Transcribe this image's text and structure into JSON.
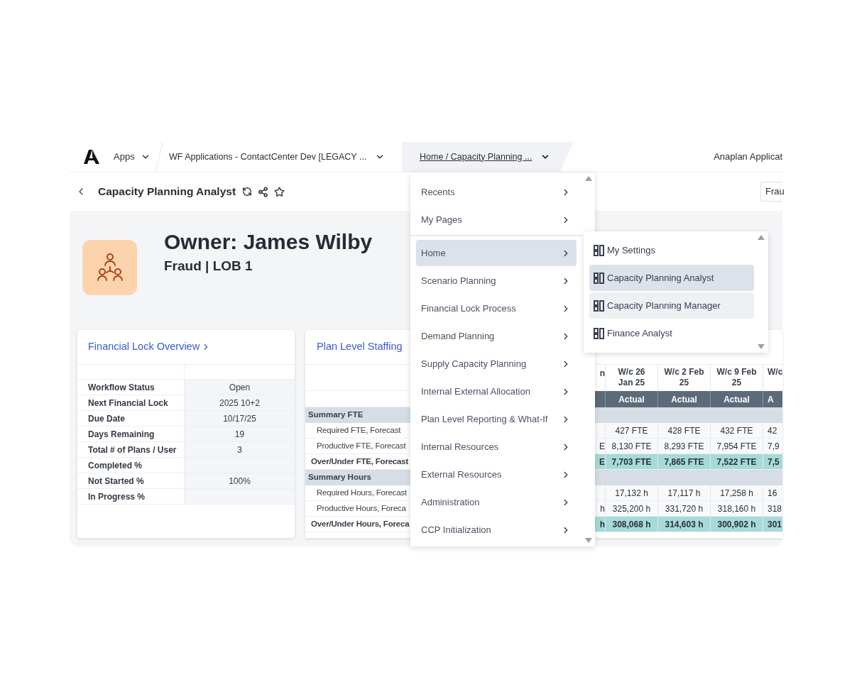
{
  "top_bar": {
    "apps": "Apps",
    "model": "WF Applications - ContactCenter Dev [LEGACY ...",
    "page": "Home / Capacity Planning ...",
    "tenant": "Anaplan Applicat"
  },
  "page_bar": {
    "title": "Capacity Planning Analyst",
    "filter": "Frau"
  },
  "header": {
    "title": "Owner: James Wilby",
    "subtitle": "Fraud | LOB 1"
  },
  "lock_card": {
    "title": "Financial Lock Overview",
    "rows": [
      {
        "label": "Workflow Status",
        "value": "Open"
      },
      {
        "label": "Next Financial Lock",
        "value": "2025 10+2"
      },
      {
        "label": "Due Date",
        "value": "10/17/25"
      },
      {
        "label": "Days Remaining",
        "value": "19"
      },
      {
        "label": "Total # of Plans / User",
        "value": "3"
      },
      {
        "label": "Completed %"
      },
      {
        "label": "Not Started %",
        "value": "100%"
      },
      {
        "label": "In Progress %"
      }
    ]
  },
  "staffing_card": {
    "title": "Plan Level Staffing",
    "edge_heading": "n",
    "columns": [
      {
        "heading": "W/c 26 Jan 25",
        "sub": "Actual"
      },
      {
        "heading": "W/c 2 Feb 25",
        "sub": "Actual"
      },
      {
        "heading": "W/c 9 Feb 25",
        "sub": "Actual"
      },
      {
        "heading": "W/c",
        "sub": "A"
      }
    ],
    "rows": [
      {
        "kind": "section",
        "label": "Summary FTE"
      },
      {
        "kind": "line",
        "label": "Required FTE, Forecast",
        "cells": [
          "427 FTE",
          "428 FTE",
          "432 FTE",
          "42"
        ]
      },
      {
        "kind": "line",
        "label": "Productive FTE, Forecast",
        "edge": "E",
        "cells": [
          "8,130 FTE",
          "8,293 FTE",
          "7,954 FTE",
          "7,9"
        ]
      },
      {
        "kind": "total",
        "label": "Over/Under FTE, Forecast",
        "edge": "E",
        "cells": [
          "7,703 FTE",
          "7,865 FTE",
          "7,522 FTE",
          "7,5"
        ]
      },
      {
        "kind": "section",
        "label": "Summary Hours"
      },
      {
        "kind": "line",
        "label": "Required Hours, Forecast",
        "cells": [
          "17,132 h",
          "17,117 h",
          "17,258 h",
          "16"
        ]
      },
      {
        "kind": "line",
        "label": "Productive Hours, Foreca",
        "edge": "h",
        "cells": [
          "325,200 h",
          "331,720 h",
          "318,160 h",
          "318"
        ]
      },
      {
        "kind": "total",
        "label": "Over/Under Hours, Foreca",
        "edge": "h",
        "cells": [
          "308,068 h",
          "314,603 h",
          "300,902 h",
          "301"
        ]
      }
    ]
  },
  "menu": {
    "groups": [
      [
        {
          "label": "Recents",
          "selected": false
        },
        {
          "label": "My Pages",
          "selected": false
        }
      ],
      [
        {
          "label": "Home",
          "selected": true
        },
        {
          "label": "Scenario Planning",
          "selected": false
        },
        {
          "label": "Financial Lock Process",
          "selected": false
        },
        {
          "label": "Demand Planning",
          "selected": false
        },
        {
          "label": "Supply Capacity Planning",
          "selected": false
        },
        {
          "label": "Internal External Allocation",
          "selected": false
        },
        {
          "label": "Plan Level Reporting & What-If",
          "selected": false
        },
        {
          "label": "Internal Resources",
          "selected": false
        },
        {
          "label": "External Resources",
          "selected": false
        },
        {
          "label": "Administration",
          "selected": false
        },
        {
          "label": "CCP Initialization",
          "selected": false
        }
      ]
    ]
  },
  "submenu": {
    "items": [
      {
        "label": "My Settings",
        "selected": false,
        "highlighted": false
      },
      {
        "label": "Capacity Planning Analyst",
        "selected": true,
        "highlighted": false
      },
      {
        "label": "Capacity Planning Manager",
        "selected": false,
        "highlighted": true
      },
      {
        "label": "Finance Analyst",
        "selected": false,
        "highlighted": false
      }
    ]
  }
}
